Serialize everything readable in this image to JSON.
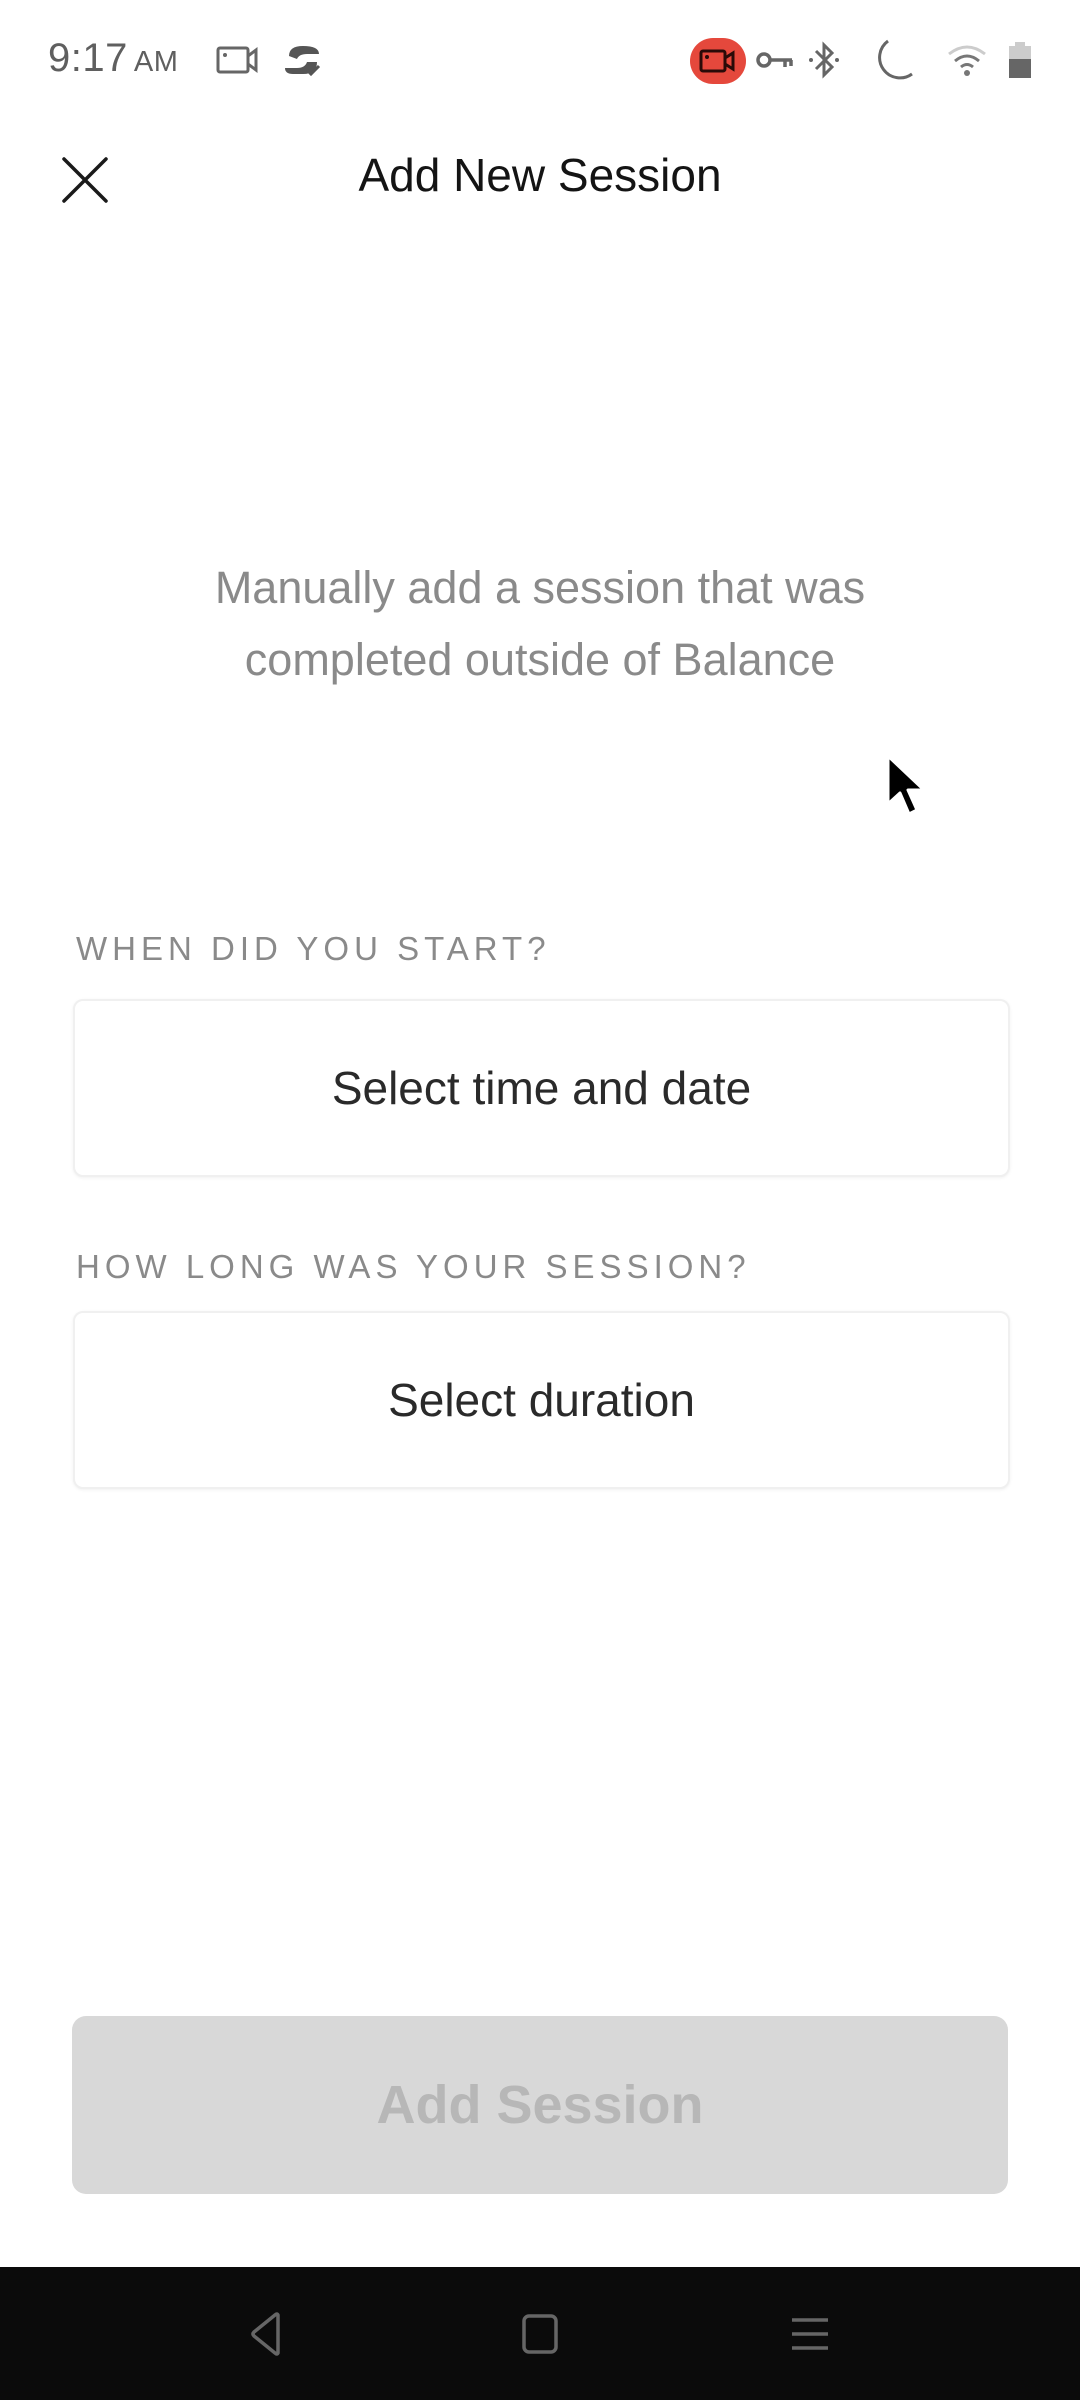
{
  "status_bar": {
    "time": "9:17",
    "ampm": "AM",
    "icons": [
      "screen-record-icon",
      "sync-check-icon",
      "recording-indicator-icon",
      "vpn-key-icon",
      "bluetooth-icon",
      "do-not-disturb-moon-icon",
      "wifi-icon",
      "battery-icon"
    ],
    "recording_color": "#e5483c"
  },
  "header": {
    "close_icon": "close-icon",
    "title": "Add New Session"
  },
  "main": {
    "subtitle": "Manually add a session that was completed outside of Balance",
    "start_field": {
      "label": "WHEN DID YOU START?",
      "placeholder": "Select time and date"
    },
    "duration_field": {
      "label": "HOW LONG WAS YOUR SESSION?",
      "placeholder": "Select duration"
    },
    "submit": {
      "label": "Add Session",
      "disabled": true
    }
  },
  "nav_bar": {
    "buttons": [
      "back-icon",
      "home-icon",
      "recents-menu-icon"
    ]
  }
}
